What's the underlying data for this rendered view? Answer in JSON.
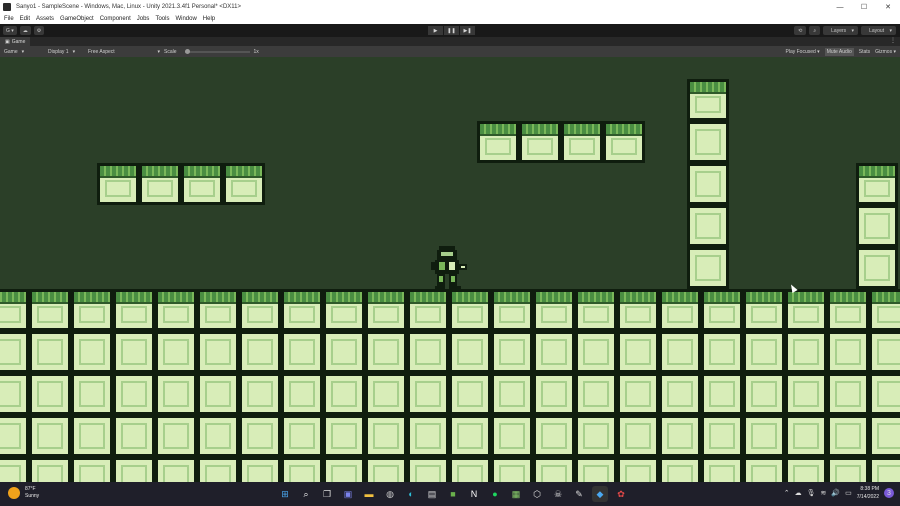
{
  "window": {
    "title": "Sanyo1 - SampleScene - Windows, Mac, Linux - Unity 2021.3.4f1 Personal* <DX11>",
    "controls": [
      "—",
      "☐",
      "✕"
    ]
  },
  "menu": [
    "File",
    "Edit",
    "Assets",
    "GameObject",
    "Component",
    "Jobs",
    "Tools",
    "Window",
    "Help"
  ],
  "toolbar": {
    "account_label": "G ▾",
    "cloud_icon": "cloud-icon",
    "settings_icon": "gear-icon",
    "play": "▶",
    "pause": "❚❚",
    "step": "▶❚",
    "history_icon": "history-icon",
    "search_icon": "search-icon",
    "layers": "Layers",
    "layout": "Layout"
  },
  "tab": {
    "label": "Game",
    "icon": "game-icon"
  },
  "game_bar": {
    "game_select": "Game",
    "display_select": "Display 1",
    "aspect_select": "Free Aspect",
    "scale_label": "Scale",
    "scale_value": "1x",
    "play_mode": "Play Focused",
    "mute_audio": "Mute Audio",
    "stats": "Stats",
    "gizmos": "Gizmos"
  },
  "colors": {
    "background": "#2b3f28",
    "tile_fill": "#d8edb8",
    "tile_outline": "#0f1d0e",
    "grass": "#4a8e42"
  },
  "taskbar": {
    "weather_temp": "87°F",
    "weather_desc": "Sunny",
    "time": "8:38 PM",
    "date": "7/14/2022",
    "notification_count": "3"
  }
}
